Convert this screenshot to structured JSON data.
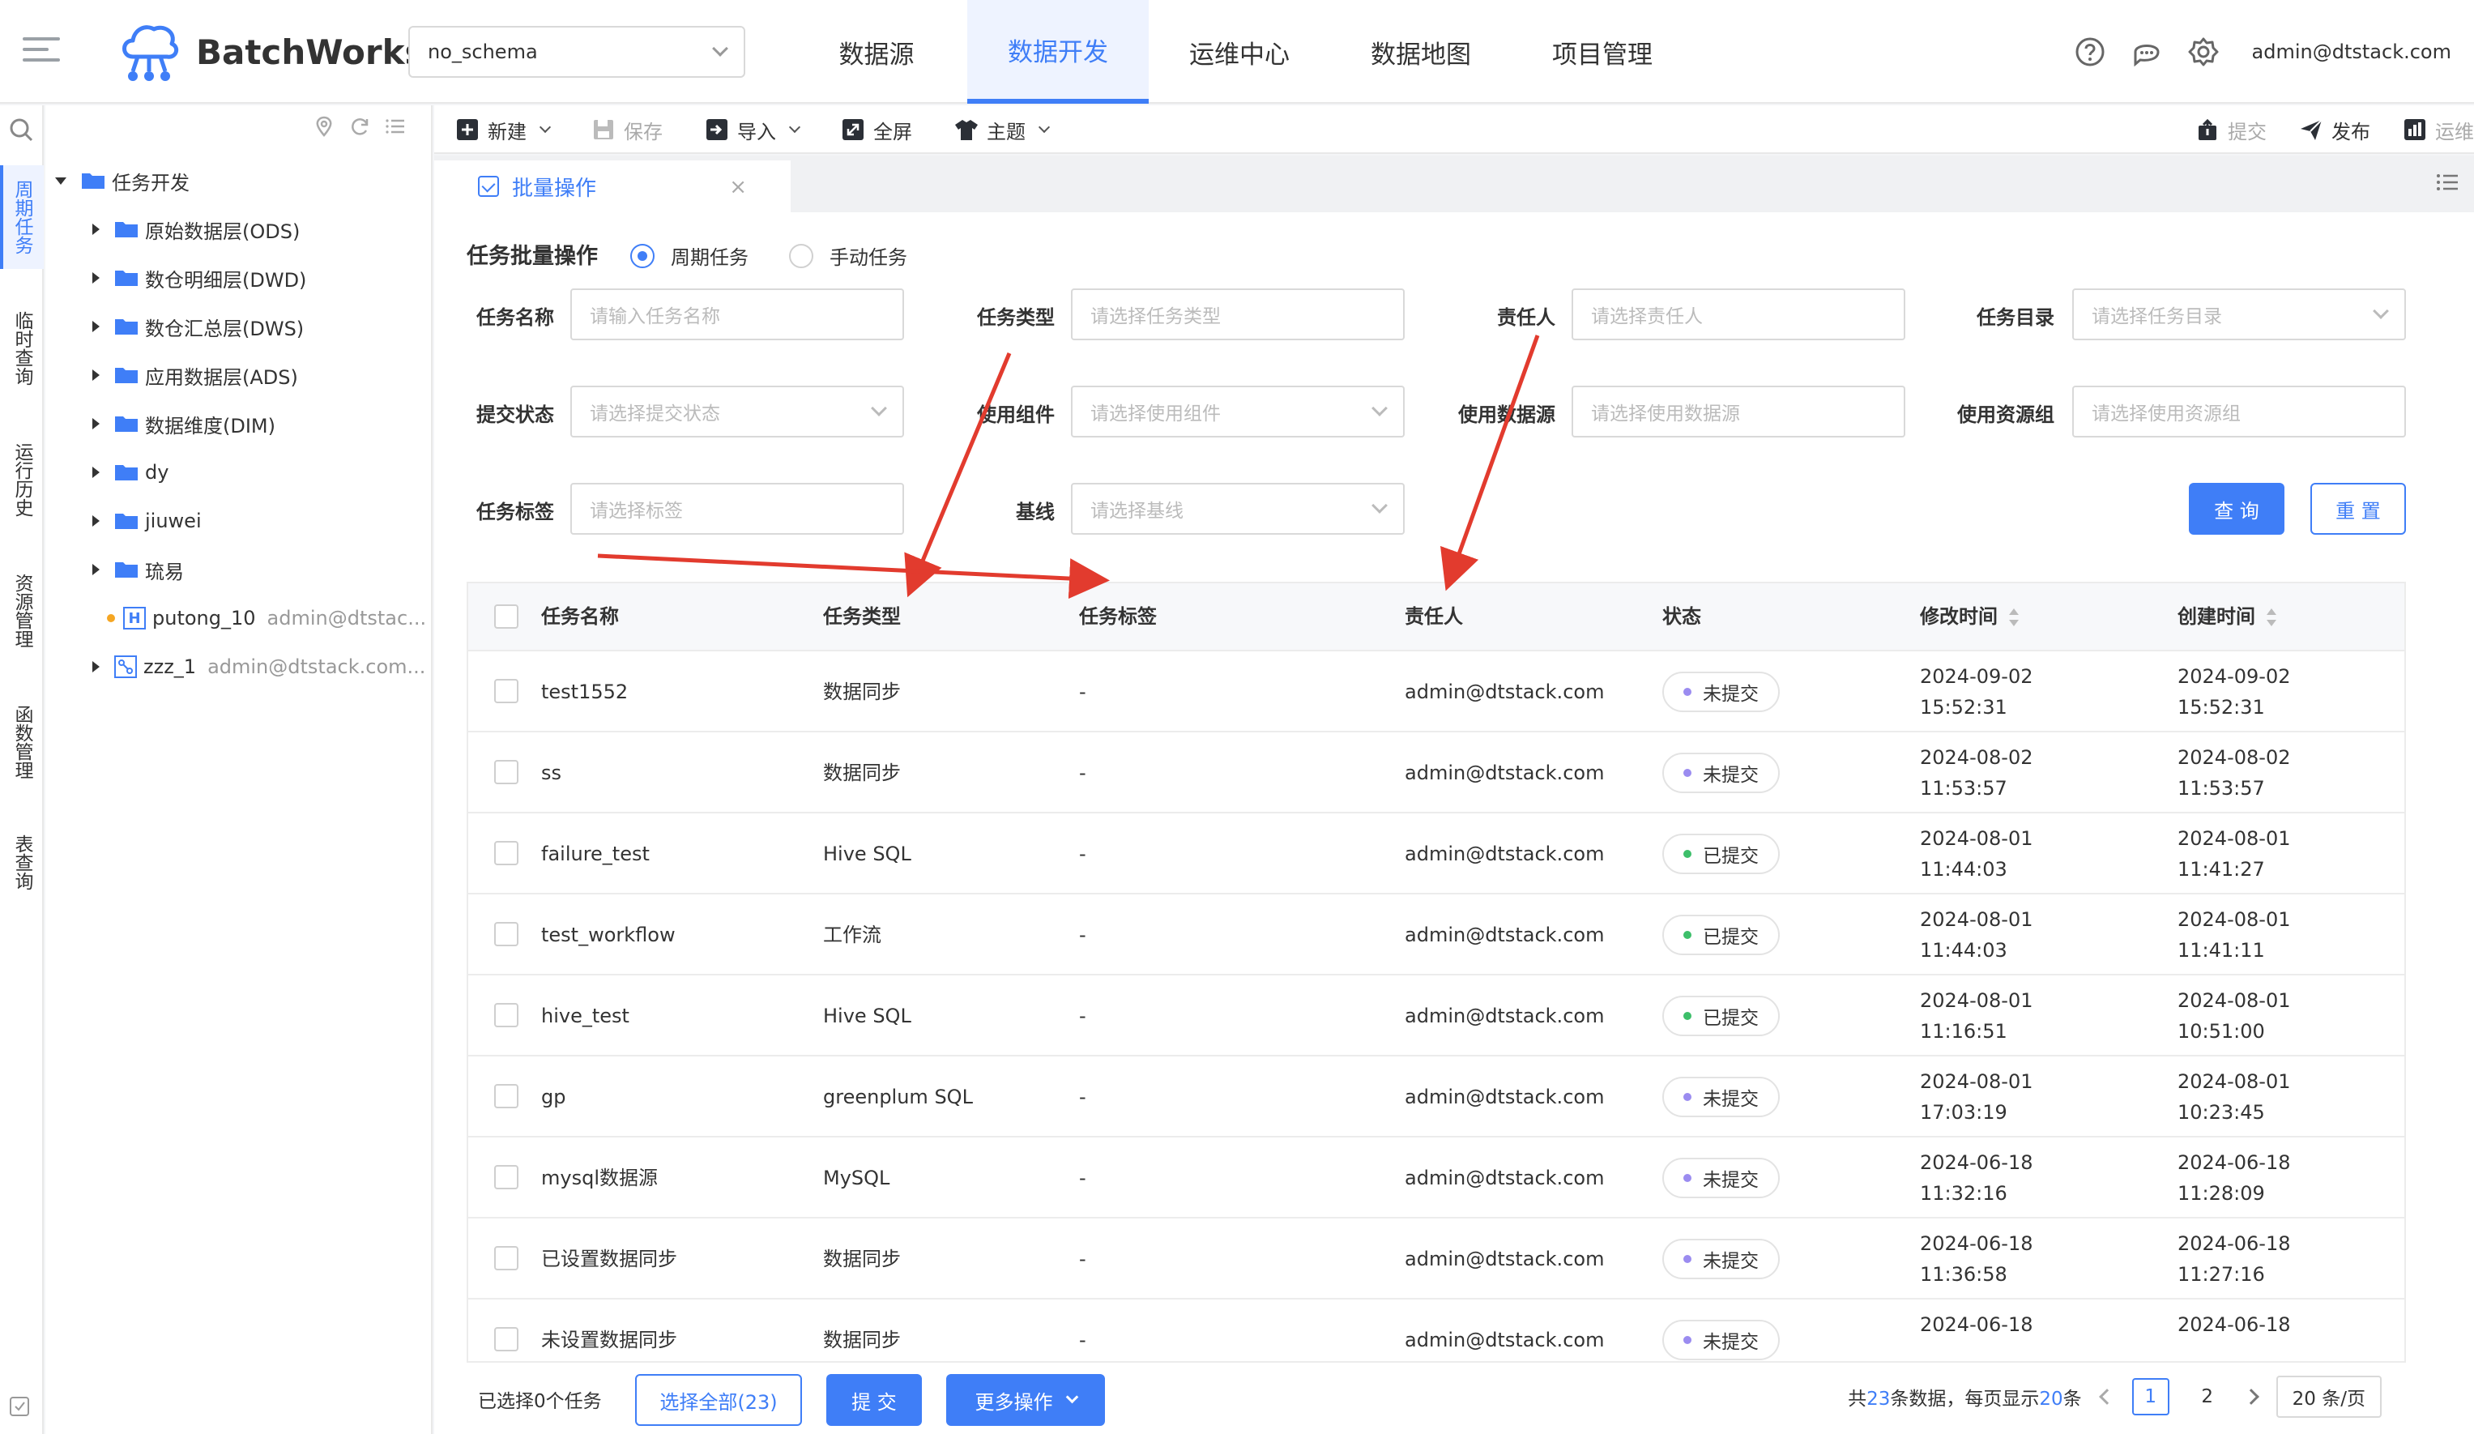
{
  "header": {
    "brand": "BatchWorks",
    "schema": "no_schema",
    "nav": [
      "数据源",
      "数据开发",
      "运维中心",
      "数据地图",
      "项目管理"
    ],
    "active_nav": 1,
    "user": "admin@dtstack.com"
  },
  "rail": {
    "items": [
      "周期任务",
      "临时查询",
      "运行历史",
      "资源管理",
      "函数管理",
      "表查询"
    ]
  },
  "tree": {
    "root": "任务开发",
    "folders": [
      "原始数据层(ODS)",
      "数仓明细层(DWD)",
      "数仓汇总层(DWS)",
      "应用数据层(ADS)",
      "数据维度(DIM)",
      "dy",
      "jiuwei",
      "琉易"
    ],
    "task1_name": "putong_10",
    "task1_owner": "admin@dtstac...",
    "task2_name": "zzz_1",
    "task2_owner": "admin@dtstack.com..."
  },
  "toolbar": {
    "new": "新建",
    "save": "保存",
    "import": "导入",
    "fullscreen": "全屏",
    "theme": "主题",
    "submit": "提交",
    "publish": "发布",
    "ops": "运维"
  },
  "tab": {
    "label": "批量操作"
  },
  "filters": {
    "title": "任务批量操作",
    "radio_periodic": "周期任务",
    "radio_manual": "手动任务",
    "task_name_label": "任务名称",
    "task_name_ph": "请输入任务名称",
    "task_type_label": "任务类型",
    "task_type_ph": "请选择任务类型",
    "owner_label": "责任人",
    "owner_ph": "请选择责任人",
    "dir_label": "任务目录",
    "dir_ph": "请选择任务目录",
    "submit_state_label": "提交状态",
    "submit_state_ph": "请选择提交状态",
    "component_label": "使用组件",
    "component_ph": "请选择使用组件",
    "datasource_label": "使用数据源",
    "datasource_ph": "请选择使用数据源",
    "resgroup_label": "使用资源组",
    "resgroup_ph": "请选择使用资源组",
    "tag_label": "任务标签",
    "tag_ph": "请选择标签",
    "baseline_label": "基线",
    "baseline_ph": "请选择基线",
    "query_btn": "查 询",
    "reset_btn": "重 置"
  },
  "table": {
    "columns": [
      "任务名称",
      "任务类型",
      "任务标签",
      "责任人",
      "状态",
      "修改时间",
      "创建时间"
    ],
    "rows": [
      {
        "name": "test1552",
        "type": "数据同步",
        "tag": "-",
        "owner": "admin@dtstack.com",
        "status": "未提交",
        "mod_date": "2024-09-02",
        "mod_time": "15:52:31",
        "cre_date": "2024-09-02",
        "cre_time": "15:52:31"
      },
      {
        "name": "ss",
        "type": "数据同步",
        "tag": "-",
        "owner": "admin@dtstack.com",
        "status": "未提交",
        "mod_date": "2024-08-02",
        "mod_time": "11:53:57",
        "cre_date": "2024-08-02",
        "cre_time": "11:53:57"
      },
      {
        "name": "failure_test",
        "type": "Hive SQL",
        "tag": "-",
        "owner": "admin@dtstack.com",
        "status": "已提交",
        "mod_date": "2024-08-01",
        "mod_time": "11:44:03",
        "cre_date": "2024-08-01",
        "cre_time": "11:41:27"
      },
      {
        "name": "test_workflow",
        "type": "工作流",
        "tag": "-",
        "owner": "admin@dtstack.com",
        "status": "已提交",
        "mod_date": "2024-08-01",
        "mod_time": "11:44:03",
        "cre_date": "2024-08-01",
        "cre_time": "11:41:11"
      },
      {
        "name": "hive_test",
        "type": "Hive SQL",
        "tag": "-",
        "owner": "admin@dtstack.com",
        "status": "已提交",
        "mod_date": "2024-08-01",
        "mod_time": "11:16:51",
        "cre_date": "2024-08-01",
        "cre_time": "10:51:00"
      },
      {
        "name": "gp",
        "type": "greenplum SQL",
        "tag": "-",
        "owner": "admin@dtstack.com",
        "status": "未提交",
        "mod_date": "2024-08-01",
        "mod_time": "17:03:19",
        "cre_date": "2024-08-01",
        "cre_time": "10:23:45"
      },
      {
        "name": "mysql数据源",
        "type": "MySQL",
        "tag": "-",
        "owner": "admin@dtstack.com",
        "status": "未提交",
        "mod_date": "2024-06-18",
        "mod_time": "11:32:16",
        "cre_date": "2024-06-18",
        "cre_time": "11:28:09"
      },
      {
        "name": "已设置数据同步",
        "type": "数据同步",
        "tag": "-",
        "owner": "admin@dtstack.com",
        "status": "未提交",
        "mod_date": "2024-06-18",
        "mod_time": "11:36:58",
        "cre_date": "2024-06-18",
        "cre_time": "11:27:16"
      },
      {
        "name": "未设置数据同步",
        "type": "数据同步",
        "tag": "-",
        "owner": "admin@dtstack.com",
        "status": "未提交",
        "mod_date": "2024-06-18",
        "mod_time": "",
        "cre_date": "2024-06-18",
        "cre_time": ""
      }
    ]
  },
  "footer": {
    "selected": "已选择0个任务",
    "select_all": "选择全部(23)",
    "submit": "提 交",
    "more": "更多操作",
    "total_prefix": "共",
    "total": "23",
    "total_mid": "条数据，每页显示",
    "per_page": "20",
    "total_suffix": "条",
    "page1": "1",
    "page2": "2",
    "page_size": "20 条/页"
  },
  "colors": {
    "accent": "#3f7ef7",
    "status_unsubmitted": "#9b8cf0",
    "status_submitted": "#3dbf6a",
    "annotation": "#e23b2e"
  }
}
